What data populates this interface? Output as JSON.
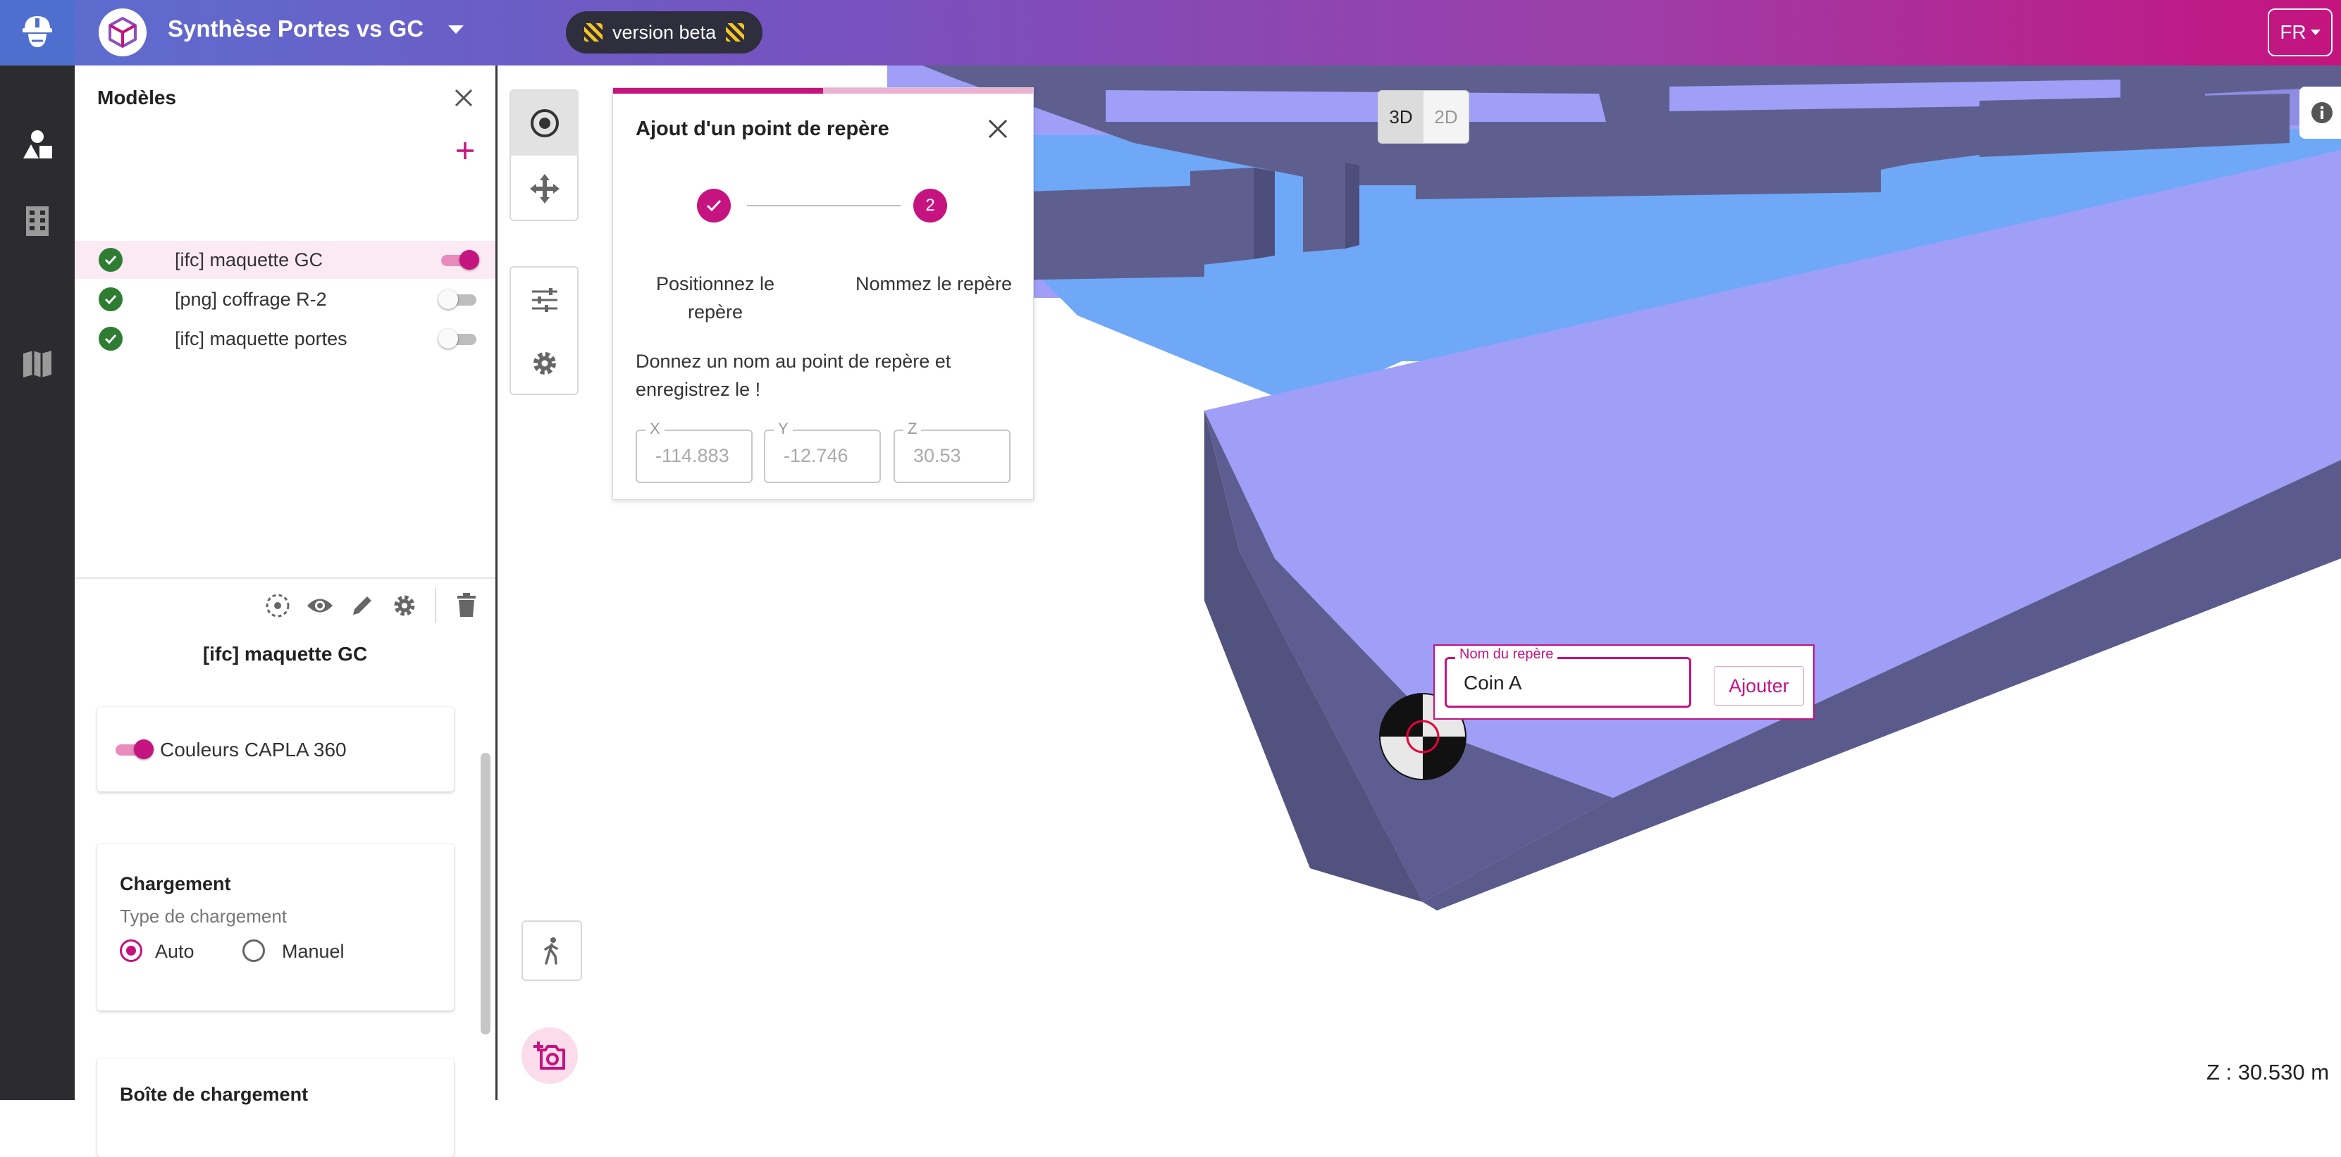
{
  "header": {
    "app_title": "Synthèse Portes vs GC",
    "beta_label": "version beta",
    "language": "FR",
    "icons": [
      "worker-helmet-icon",
      "cube-icon",
      "chevron-down-icon"
    ]
  },
  "rail": {
    "items": [
      {
        "name": "shapes-icon",
        "active": true
      },
      {
        "name": "building-icon",
        "active": false
      },
      {
        "name": "map-book-icon",
        "active": false
      }
    ]
  },
  "models_panel": {
    "title": "Modèles",
    "models": [
      {
        "label": "[ifc] maquette GC",
        "visible": true,
        "selected": true
      },
      {
        "label": "[png] coffrage R-2",
        "visible": false,
        "selected": false
      },
      {
        "label": "[ifc] maquette portes",
        "visible": false,
        "selected": false
      }
    ],
    "selected_model_title": "[ifc] maquette GC",
    "colors_toggle_label": "Couleurs CAPLA 360",
    "colors_toggle_on": true,
    "loading": {
      "title": "Chargement",
      "type_label": "Type de chargement",
      "options": [
        "Auto",
        "Manuel"
      ],
      "selected": "Auto"
    },
    "loading_box_title": "Boîte de chargement"
  },
  "viewport": {
    "view_modes": [
      "3D",
      "2D"
    ],
    "active_view_mode": "3D",
    "z_readout": "Z : 30.530 m"
  },
  "landmark_dialog": {
    "title": "Ajout d'un point de repère",
    "progress_fraction": 0.5,
    "steps": [
      {
        "label": "Positionnez le repère",
        "state": "done"
      },
      {
        "label": "Nommez le repère",
        "number": "2",
        "state": "active"
      }
    ],
    "instruction": "Donnez un nom au point de repère et enregistrez le !",
    "coords": [
      {
        "label": "X",
        "value": "-114.883"
      },
      {
        "label": "Y",
        "value": "-12.746"
      },
      {
        "label": "Z",
        "value": "30.53"
      }
    ]
  },
  "name_popup": {
    "field_label": "Nom du repère",
    "value": "Coin A",
    "button_label": "Ajouter"
  },
  "colors": {
    "accent": "#c5137f",
    "success": "#2e7d32",
    "rail_bg": "#2b2b30"
  }
}
